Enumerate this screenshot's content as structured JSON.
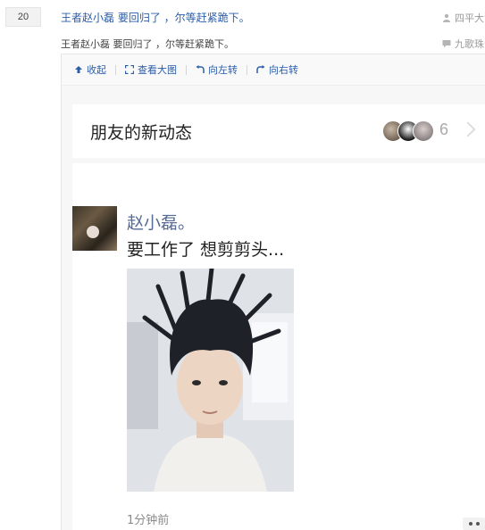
{
  "thread": {
    "rank": "20",
    "title": "王者赵小磊 要回归了 ，尔等赶紧跪下。",
    "summary": "王者赵小磊 要回归了 ，尔等赶紧跪下。",
    "author": "四平大",
    "forum": "九歌珠"
  },
  "toolbar": {
    "collapse": "收起",
    "view_large": "查看大图",
    "rotate_left": "向左转",
    "rotate_right": "向右转"
  },
  "moments": {
    "title": "朋友的新动态",
    "count": "6"
  },
  "post": {
    "name": "赵小磊。",
    "text": "要工作了 想剪剪头...",
    "time": "1分钟前"
  },
  "colors": {
    "link": "#2a5caa",
    "wechat_name": "#576b95"
  }
}
